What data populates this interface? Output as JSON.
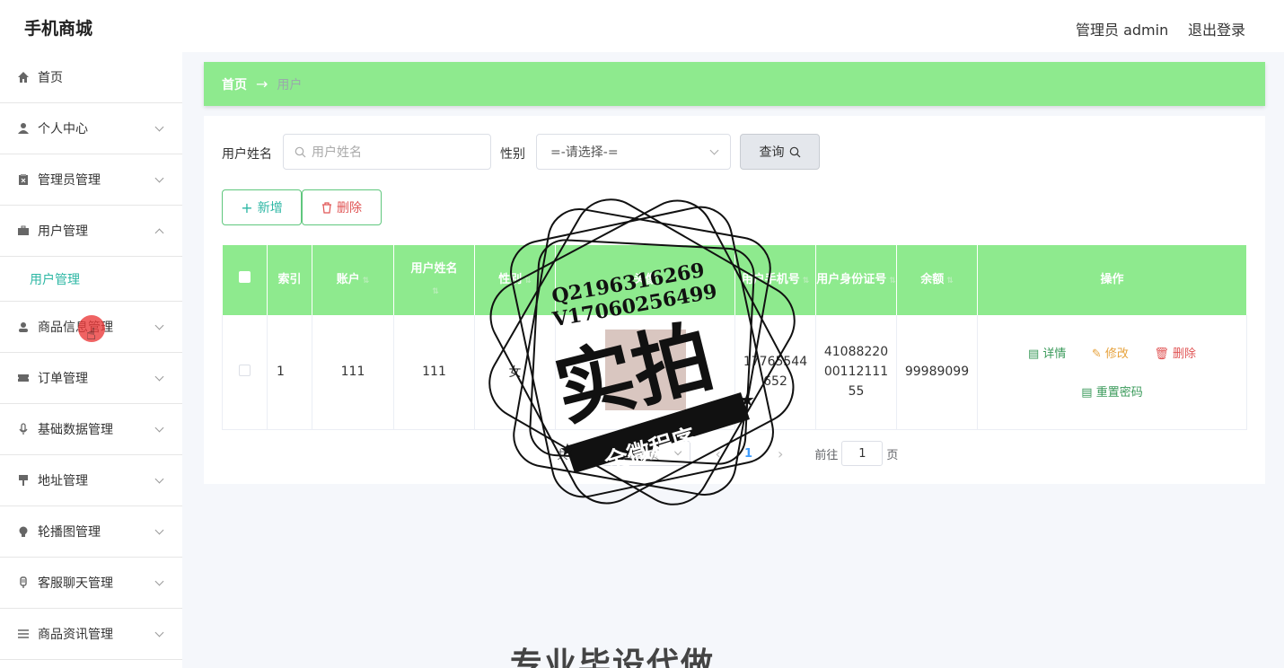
{
  "header": {
    "brand": "手机商城",
    "admin_label": "管理员 admin",
    "logout": "退出登录"
  },
  "sidebar": {
    "items": [
      {
        "label": "首页",
        "icon": "home-icon"
      },
      {
        "label": "个人中心",
        "icon": "user-icon"
      },
      {
        "label": "管理员管理",
        "icon": "clipboard-icon"
      },
      {
        "label": "用户管理",
        "icon": "briefcase-icon",
        "sub": "用户管理"
      },
      {
        "label": "商品信息管理",
        "icon": "person-icon"
      },
      {
        "label": "订单管理",
        "icon": "ticket-icon"
      },
      {
        "label": "基础数据管理",
        "icon": "microphone-icon"
      },
      {
        "label": "地址管理",
        "icon": "brush-icon"
      },
      {
        "label": "轮播图管理",
        "icon": "bulb-icon"
      },
      {
        "label": "客服聊天管理",
        "icon": "mic-icon"
      },
      {
        "label": "商品资讯管理",
        "icon": "list-icon"
      }
    ]
  },
  "breadcrumb": {
    "home": "首页",
    "arrow": "→",
    "current": "用户"
  },
  "search": {
    "name_label": "用户姓名",
    "name_placeholder": "用户姓名",
    "gender_label": "性别",
    "gender_value": "=-请选择-=",
    "query_button": "查询"
  },
  "actions": {
    "add": "新增",
    "delete": "删除"
  },
  "table": {
    "columns": [
      "索引",
      "账户",
      "用户姓名",
      "性别",
      "头像",
      "用户手机号",
      "用户身份证号",
      "余额",
      "操作"
    ],
    "rows": [
      {
        "index": "1",
        "account": "111",
        "name": "111",
        "gender": "女",
        "phone": "17765544652",
        "id_card": "410882200011211155",
        "balance": "99989099"
      }
    ],
    "row_actions": {
      "detail": "详情",
      "edit": "修改",
      "delete": "删除",
      "reset": "重置密码"
    }
  },
  "pager": {
    "total": "共 1 条",
    "page_size": "10条/页",
    "current": "1",
    "goto_label": "前往",
    "goto_value": "1",
    "page_unit": "页"
  },
  "watermark": {
    "qq": "Q2196316269",
    "wx": "V17060256499",
    "big": "实拍",
    "ribbon": "全微程序"
  },
  "bottom_text": "专业毕设代做",
  "colors": {
    "accent_green": "#8eea8e",
    "teal": "#2db7a4",
    "danger": "#e05555",
    "warning": "#e6a23c"
  }
}
